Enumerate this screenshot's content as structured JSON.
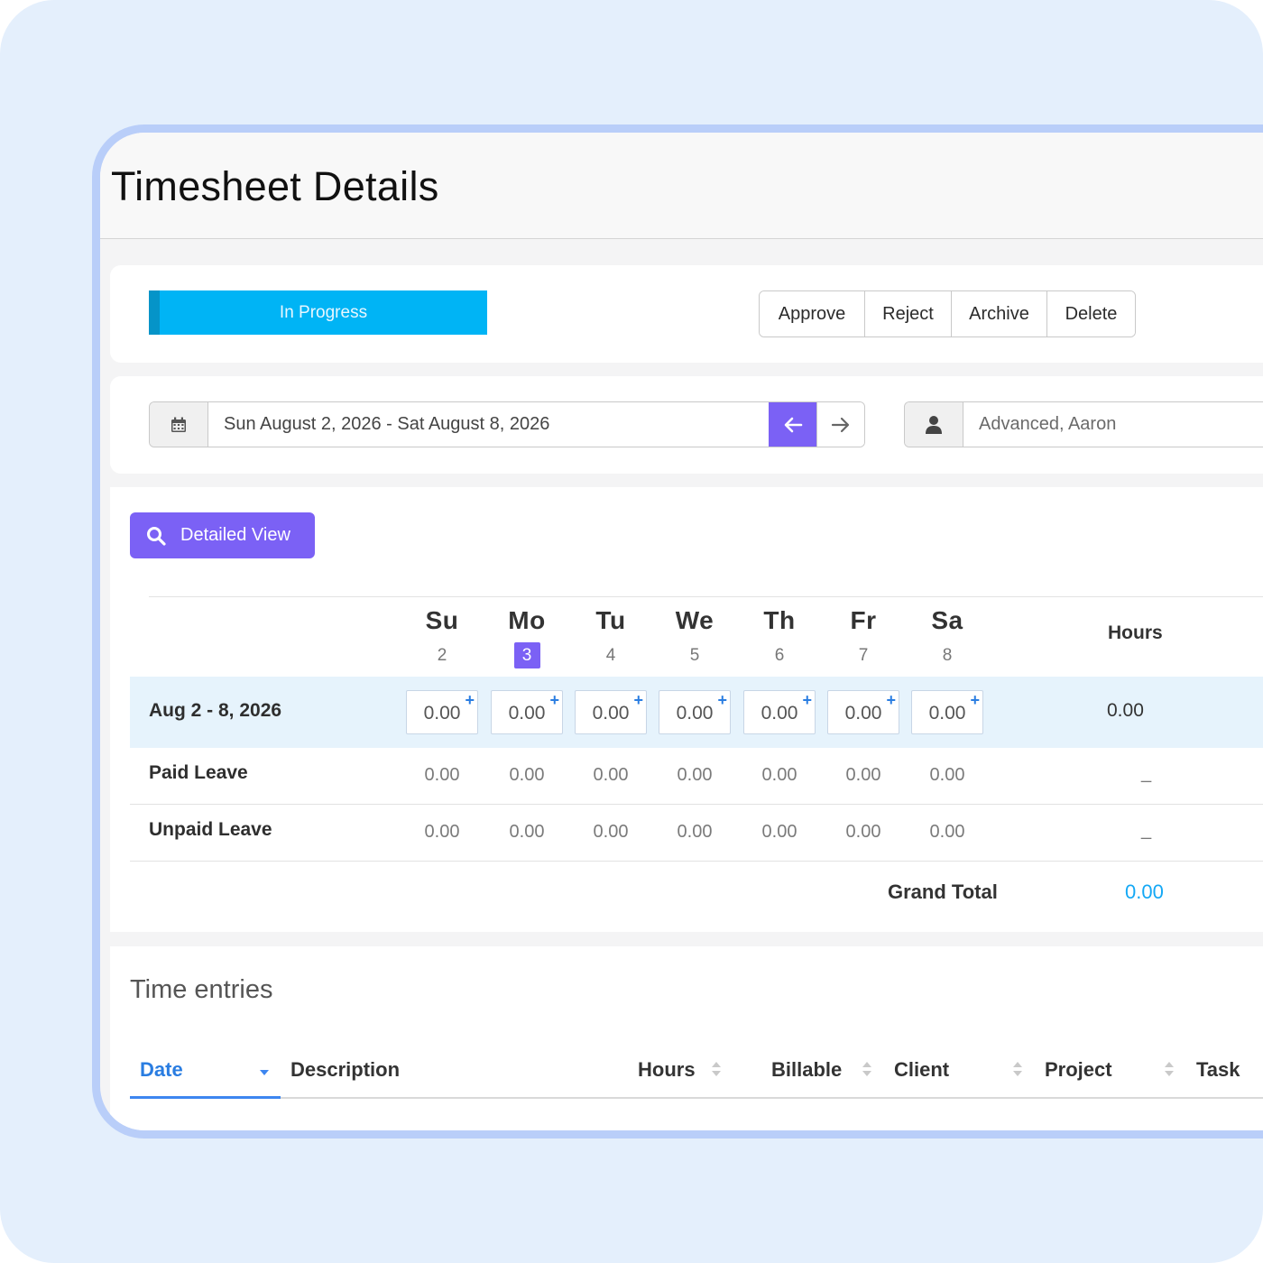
{
  "page": {
    "title": "Timesheet Details"
  },
  "status": {
    "label": "In Progress",
    "color": "#00b4f5"
  },
  "actions": [
    "Approve",
    "Reject",
    "Archive",
    "Delete"
  ],
  "range": {
    "text": "Sun August 2, 2026 - Sat August 8, 2026",
    "icon": "calendar-icon",
    "prev_icon": "arrow-left-icon",
    "next_icon": "arrow-right-icon"
  },
  "user": {
    "name": "Advanced, Aaron",
    "icon": "user-icon"
  },
  "detailed_view": {
    "label": "Detailed View",
    "icon": "search-icon"
  },
  "grid": {
    "days": [
      {
        "name": "Su",
        "num": "2"
      },
      {
        "name": "Mo",
        "num": "3",
        "today": true
      },
      {
        "name": "Tu",
        "num": "4"
      },
      {
        "name": "We",
        "num": "5"
      },
      {
        "name": "Th",
        "num": "6"
      },
      {
        "name": "Fr",
        "num": "7"
      },
      {
        "name": "Sa",
        "num": "8"
      }
    ],
    "hours_header": "Hours",
    "week_row": {
      "label": "Aug 2 - 8, 2026",
      "values": [
        "0.00",
        "0.00",
        "0.00",
        "0.00",
        "0.00",
        "0.00",
        "0.00"
      ],
      "add_symbol": "+",
      "total": "0.00"
    },
    "leave_rows": [
      {
        "label": "Paid Leave",
        "values": [
          "0.00",
          "0.00",
          "0.00",
          "0.00",
          "0.00",
          "0.00",
          "0.00"
        ],
        "total": "_"
      },
      {
        "label": "Unpaid Leave",
        "values": [
          "0.00",
          "0.00",
          "0.00",
          "0.00",
          "0.00",
          "0.00",
          "0.00"
        ],
        "total": "_"
      }
    ],
    "grand_total_label": "Grand Total",
    "grand_total_value": "0.00",
    "accent_color": "#7b61f5",
    "total_color": "#14a8f5"
  },
  "entries": {
    "title": "Time entries",
    "columns": [
      "Date",
      "Description",
      "Hours",
      "Billable",
      "Client",
      "Project",
      "Task"
    ],
    "active_sort_column": "Date"
  }
}
